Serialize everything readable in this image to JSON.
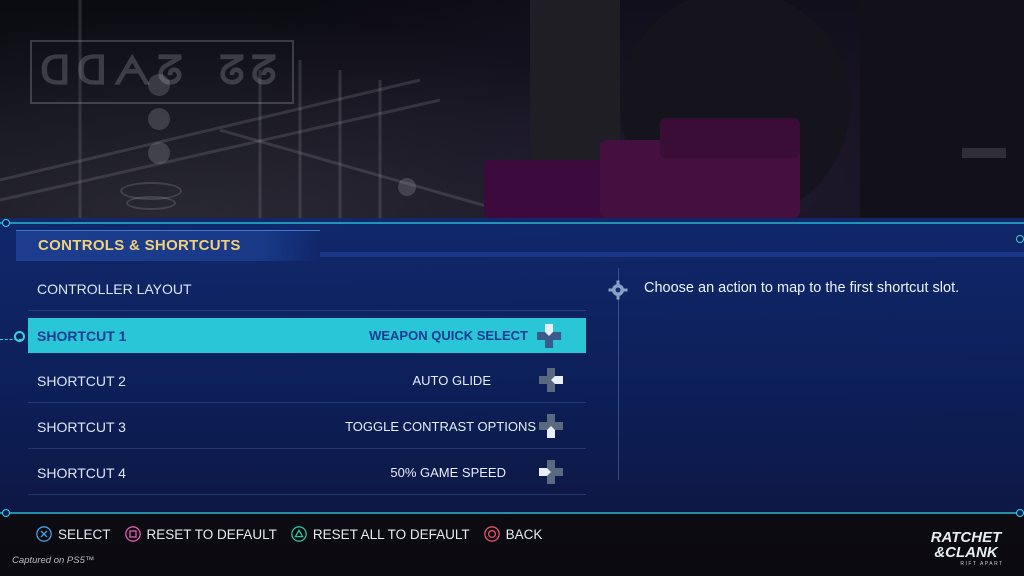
{
  "menu": {
    "title": "CONTROLS & SHORTCUTS",
    "rows": [
      {
        "label": "CONTROLLER LAYOUT",
        "value": "",
        "dpad": ""
      },
      {
        "label": "SHORTCUT 1",
        "value": "WEAPON QUICK SELECT",
        "dpad": "dpad-up-icon",
        "selected": true
      },
      {
        "label": "SHORTCUT 2",
        "value": "AUTO GLIDE",
        "dpad": "dpad-right-icon"
      },
      {
        "label": "SHORTCUT 3",
        "value": "TOGGLE CONTRAST OPTIONS",
        "dpad": "dpad-down-icon"
      },
      {
        "label": "SHORTCUT 4",
        "value": "50% GAME SPEED",
        "dpad": "dpad-left-icon"
      }
    ]
  },
  "description": {
    "icon": "gear-icon",
    "text": "Choose an action to map to the first shortcut slot."
  },
  "prompts": [
    {
      "icon": "cross-button-icon",
      "label": "SELECT",
      "color": "#4aa3e8"
    },
    {
      "icon": "square-button-icon",
      "label": "RESET TO DEFAULT",
      "color": "#e45fb1"
    },
    {
      "icon": "triangle-button-icon",
      "label": "RESET ALL TO DEFAULT",
      "color": "#2ec4a0"
    },
    {
      "icon": "circle-button-icon",
      "label": "BACK",
      "color": "#f0506a"
    }
  ],
  "footer": {
    "captured": "Captured on PS5™",
    "logo": "RATCHET & CLANK RIFT APART"
  },
  "colors": {
    "accent_cyan": "#29c6d8",
    "title_gold": "#f1d27a",
    "panel_blue": "#10286e",
    "selected_text": "#1a3b93"
  }
}
